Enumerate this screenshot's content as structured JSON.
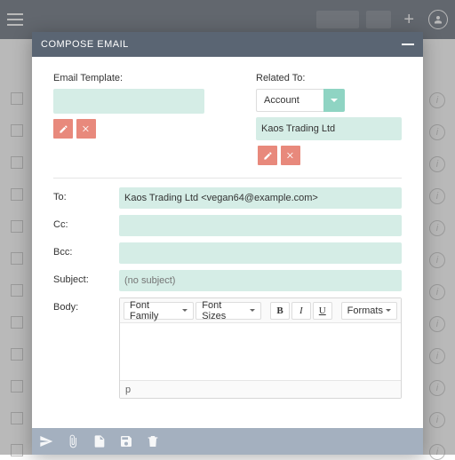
{
  "header": {
    "title": "COMPOSE EMAIL"
  },
  "form": {
    "template_label": "Email Template:",
    "template_value": "",
    "related_label": "Related To:",
    "related_module": "Account",
    "related_value": "Kaos Trading Ltd",
    "to_label": "To:",
    "to_value": "Kaos Trading Ltd <vegan64@example.com>",
    "cc_label": "Cc:",
    "cc_value": "",
    "bcc_label": "Bcc:",
    "bcc_value": "",
    "subject_label": "Subject:",
    "subject_placeholder": "(no subject)",
    "subject_value": "",
    "body_label": "Body:"
  },
  "editor": {
    "font_family_label": "Font Family",
    "font_sizes_label": "Font Sizes",
    "formats_label": "Formats",
    "bold": "B",
    "italic": "I",
    "underline": "U",
    "status_path": "p"
  },
  "icons": {
    "pencil": "pencil-icon",
    "clear": "close-icon"
  }
}
